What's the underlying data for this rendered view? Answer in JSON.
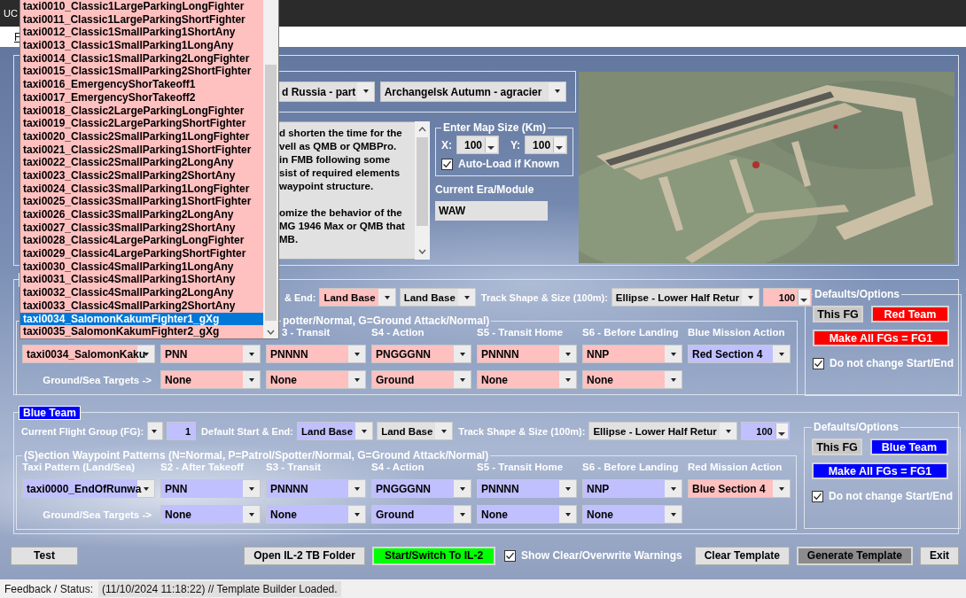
{
  "window": {
    "title": "UC"
  },
  "menu": [
    {
      "label": "F"
    }
  ],
  "scenario": {
    "map_combo": "d Russia - part",
    "mission_combo": "Archangelsk Autumn - agracier",
    "description": "d shorten the time for the\nvell as QMB or QMBPro.\nin FMB following some\nsist of required elements\nwaypoint structure.\n\nomize the behavior of the\nMG 1946 Max or QMB that\nMB.",
    "map_size": {
      "title": "Enter Map Size (Km)",
      "x_label": "X:",
      "x_value": "100",
      "y_label": "Y:",
      "y_value": "100",
      "auto_load": {
        "label": "Auto-Load if Known",
        "checked": true
      }
    },
    "era": {
      "label": "Current Era/Module",
      "value": "WAW"
    }
  },
  "teams": [
    {
      "kind": "red",
      "row1": [
        {
          "kind": "label",
          "text": "& End:"
        },
        {
          "kind": "combo",
          "text": "Land Base",
          "tinted": true
        },
        {
          "kind": "combo",
          "text": "Land Base",
          "tinted": false
        },
        {
          "kind": "label",
          "text": "Track Shape & Size (100m):"
        },
        {
          "kind": "combo",
          "text": "Ellipse - Lower Half Retur",
          "tinted": false
        },
        {
          "kind": "spin",
          "text": "100"
        }
      ],
      "sections": {
        "legend": "potter/Normal, G=Ground Attack/Normal)",
        "headers": [
          "3 - Transit",
          "S4 - Action",
          "S5 - Transit Home",
          "S6 - Before Landing",
          "Blue Mission Action"
        ],
        "patterns": [
          "taxi0034_SalomonKaku",
          "PNN",
          "PNNNN",
          "PNGGGNN",
          "PNNNN",
          "NNP",
          "Red Section 4"
        ],
        "targets_label": "Ground/Sea Targets ->",
        "targets": [
          "None",
          "None",
          "Ground",
          "None",
          "None"
        ]
      },
      "defaults": {
        "title": "Defaults/Options",
        "this_fg": "This FG",
        "team_button": "Red Team",
        "make_all": "Make All FGs = FG1",
        "keep": {
          "label": "Do not change Start/End",
          "checked": true
        }
      }
    },
    {
      "kind": "blue",
      "tag": "Blue Team",
      "row1": [
        {
          "kind": "label",
          "text": "Current Flight Group (FG):"
        },
        {
          "kind": "combo"
        },
        {
          "kind": "number",
          "text": "1"
        },
        {
          "kind": "label",
          "text": "Default Start & End:"
        },
        {
          "kind": "combo",
          "text": "Land Base",
          "tinted": true
        },
        {
          "kind": "combo",
          "text": "Land Base",
          "tinted": false
        },
        {
          "kind": "label",
          "text": "Track Shape & Size (100m):"
        },
        {
          "kind": "combo",
          "text": "Ellipse - Lower Half Retur",
          "tinted": false
        },
        {
          "kind": "spin",
          "text": "100"
        }
      ],
      "sections": {
        "legend": "(S)ection Waypoint Patterns (N=Normal, P=Patrol/Spotter/Normal, G=Ground Attack/Normal)",
        "headers": [
          "Taxi Pattern (Land/Sea)",
          "S2 - After Takeoff",
          "S3 - Transit",
          "S4 - Action",
          "S5 - Transit Home",
          "S6 - Before Landing",
          "Red Mission Action"
        ],
        "patterns": [
          "taxi0000_EndOfRunwa",
          "PNN",
          "PNNNN",
          "PNGGGNN",
          "PNNNN",
          "NNP",
          "Blue Section 4"
        ],
        "targets_label": "Ground/Sea Targets ->",
        "targets": [
          "None",
          "None",
          "Ground",
          "None",
          "None"
        ]
      },
      "defaults": {
        "title": "Defaults/Options",
        "this_fg": "This FG",
        "team_button": "Blue Team",
        "make_all": "Make All FGs = FG1",
        "keep": {
          "label": "Do not change Start/End",
          "checked": true
        }
      }
    }
  ],
  "bottom_bar": [
    {
      "kind": "button",
      "label": "Test"
    },
    {
      "kind": "button",
      "label": "Open IL-2 TB Folder"
    },
    {
      "kind": "accent-button",
      "label": "Start/Switch To IL-2"
    },
    {
      "kind": "checkbox",
      "label": "Show Clear/Overwrite Warnings",
      "checked": true
    },
    {
      "kind": "button",
      "label": "Clear Template"
    },
    {
      "kind": "pressed-button",
      "label": "Generate Template"
    },
    {
      "kind": "button",
      "label": "Exit"
    }
  ],
  "status": {
    "label": "Feedback / Status:",
    "message": "(11/10/2024 11:18:22) // Template Builder Loaded."
  },
  "open_list": {
    "items": [
      {
        "label": "taxi0010_Classic1LargeParkingLongFighter",
        "selected": false
      },
      {
        "label": "taxi0011_Classic1LargeParkingShortFighter",
        "selected": false
      },
      {
        "label": "taxi0012_Classic1SmallParking1ShortAny",
        "selected": false
      },
      {
        "label": "taxi0013_Classic1SmallParking1LongAny",
        "selected": false
      },
      {
        "label": "taxi0014_Classic1SmallParking2LongFighter",
        "selected": false
      },
      {
        "label": "taxi0015_Classic1SmallParking2ShortFighter",
        "selected": false
      },
      {
        "label": "taxi0016_EmergencyShorTakeoff1",
        "selected": false
      },
      {
        "label": "taxi0017_EmergencyShorTakeoff2",
        "selected": false
      },
      {
        "label": "taxi0018_Classic2LargeParkingLongFighter",
        "selected": false
      },
      {
        "label": "taxi0019_Classic2LargeParkingShortFighter",
        "selected": false
      },
      {
        "label": "taxi0020_Classic2SmallParking1LongFighter",
        "selected": false
      },
      {
        "label": "taxi0021_Classic2SmallParking1ShortFighter",
        "selected": false
      },
      {
        "label": "taxi0022_Classic2SmallParking2LongAny",
        "selected": false
      },
      {
        "label": "taxi0023_Classic2SmallParking2ShortAny",
        "selected": false
      },
      {
        "label": "taxi0024_Classic3SmallParking1LongFighter",
        "selected": false
      },
      {
        "label": "taxi0025_Classic3SmallParking1ShortFighter",
        "selected": false
      },
      {
        "label": "taxi0026_Classic3SmallParking2LongAny",
        "selected": false
      },
      {
        "label": "taxi0027_Classic3SmallParking2ShortAny",
        "selected": false
      },
      {
        "label": "taxi0028_Classic4LargeParkingLongFighter",
        "selected": false
      },
      {
        "label": "taxi0029_Classic4LargeParkingShortFighter",
        "selected": false
      },
      {
        "label": "taxi0030_Classic4SmallParking1LongAny",
        "selected": false
      },
      {
        "label": "taxi0031_Classic4SmallParking1ShortAny",
        "selected": false
      },
      {
        "label": "taxi0032_Classic4SmallParking2LongAny",
        "selected": false
      },
      {
        "label": "taxi0033_Classic4SmallParking2ShortAny",
        "selected": false
      },
      {
        "label": "taxi0034_SalomonKakumFighter1_gXg",
        "selected": true
      },
      {
        "label": "taxi0035_SalomonKakumFighter2_gXg",
        "selected": false
      }
    ]
  }
}
